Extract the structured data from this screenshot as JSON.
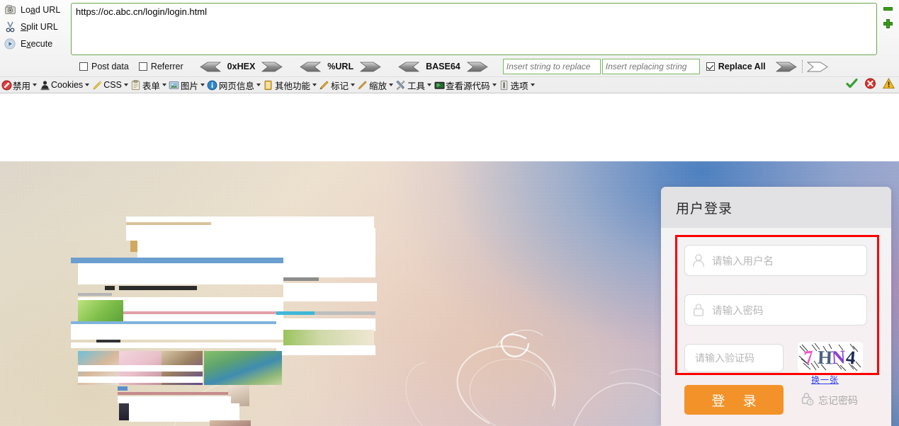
{
  "toolbar": {
    "commands": [
      {
        "icon": "load-url-icon",
        "label_pre": "Lo",
        "label_key": "a",
        "label_post": "d URL",
        "name": "load-url"
      },
      {
        "icon": "split-url-icon",
        "label_pre": "",
        "label_key": "S",
        "label_post": "plit URL",
        "name": "split-url"
      },
      {
        "icon": "execute-icon",
        "label_pre": "E",
        "label_key": "x",
        "label_post": "ecute",
        "name": "execute"
      }
    ],
    "url_value": "https://oc.abc.cn/login/login.html",
    "url_placeholder": "",
    "zoom_out_label": "-",
    "zoom_in_label": "+",
    "checkboxes": [
      {
        "label": "Post data",
        "checked": false,
        "name": "post-data"
      },
      {
        "label": "Referrer",
        "checked": false,
        "name": "referrer"
      }
    ],
    "encoders": [
      {
        "label": "0xHEX"
      },
      {
        "label": "%URL"
      },
      {
        "label": "BASE64"
      }
    ],
    "replace_find_placeholder": "Insert string to replace",
    "replace_with_placeholder": "Insert replacing string",
    "replace_find_value": "",
    "replace_with_value": "",
    "replace_all_label": "Replace All",
    "replace_all_checked": true
  },
  "menubar": {
    "items": [
      {
        "label": "禁用",
        "icon": "disable-icon",
        "name": "disable"
      },
      {
        "label": "Cookies",
        "icon": "cookies-icon",
        "name": "cookies"
      },
      {
        "label": "CSS",
        "icon": "css-icon",
        "name": "css"
      },
      {
        "label": "表单",
        "icon": "forms-icon",
        "name": "forms"
      },
      {
        "label": "图片",
        "icon": "images-icon",
        "name": "images"
      },
      {
        "label": "网页信息",
        "icon": "info-icon",
        "name": "page-info"
      },
      {
        "label": "其他功能",
        "icon": "misc-icon",
        "name": "misc"
      },
      {
        "label": "标记",
        "icon": "outline-icon",
        "name": "outline"
      },
      {
        "label": "缩放",
        "icon": "resize-icon",
        "name": "resize"
      },
      {
        "label": "工具",
        "icon": "tools-icon",
        "name": "tools"
      },
      {
        "label": "查看源代码",
        "icon": "view-source-icon",
        "name": "view-source"
      },
      {
        "label": "选项",
        "icon": "options-icon",
        "name": "options"
      }
    ],
    "status_icons": [
      {
        "icon": "check-ok-icon",
        "name": "validation-ok"
      },
      {
        "icon": "error-icon",
        "name": "validation-error"
      },
      {
        "icon": "warning-icon",
        "name": "validation-warning"
      }
    ]
  },
  "login": {
    "title": "用户登录",
    "username_placeholder": "请输入用户名",
    "username_value": "",
    "password_placeholder": "请输入密码",
    "password_value": "",
    "captcha_placeholder": "请输入验证码",
    "captcha_value": "",
    "captcha_text": "7HN4",
    "captcha_chars": [
      {
        "char": "7",
        "color": "#f052c8"
      },
      {
        "char": "H",
        "color": "#4b6382"
      },
      {
        "char": "N",
        "color": "#8b3fd6"
      },
      {
        "char": "4",
        "color": "#1b2a56"
      }
    ],
    "refresh_label": "换一张",
    "submit_label": "登 录",
    "forgot_label": "忘记密码",
    "highlight_color": "#fe0000",
    "accent_color": "#f39229"
  }
}
